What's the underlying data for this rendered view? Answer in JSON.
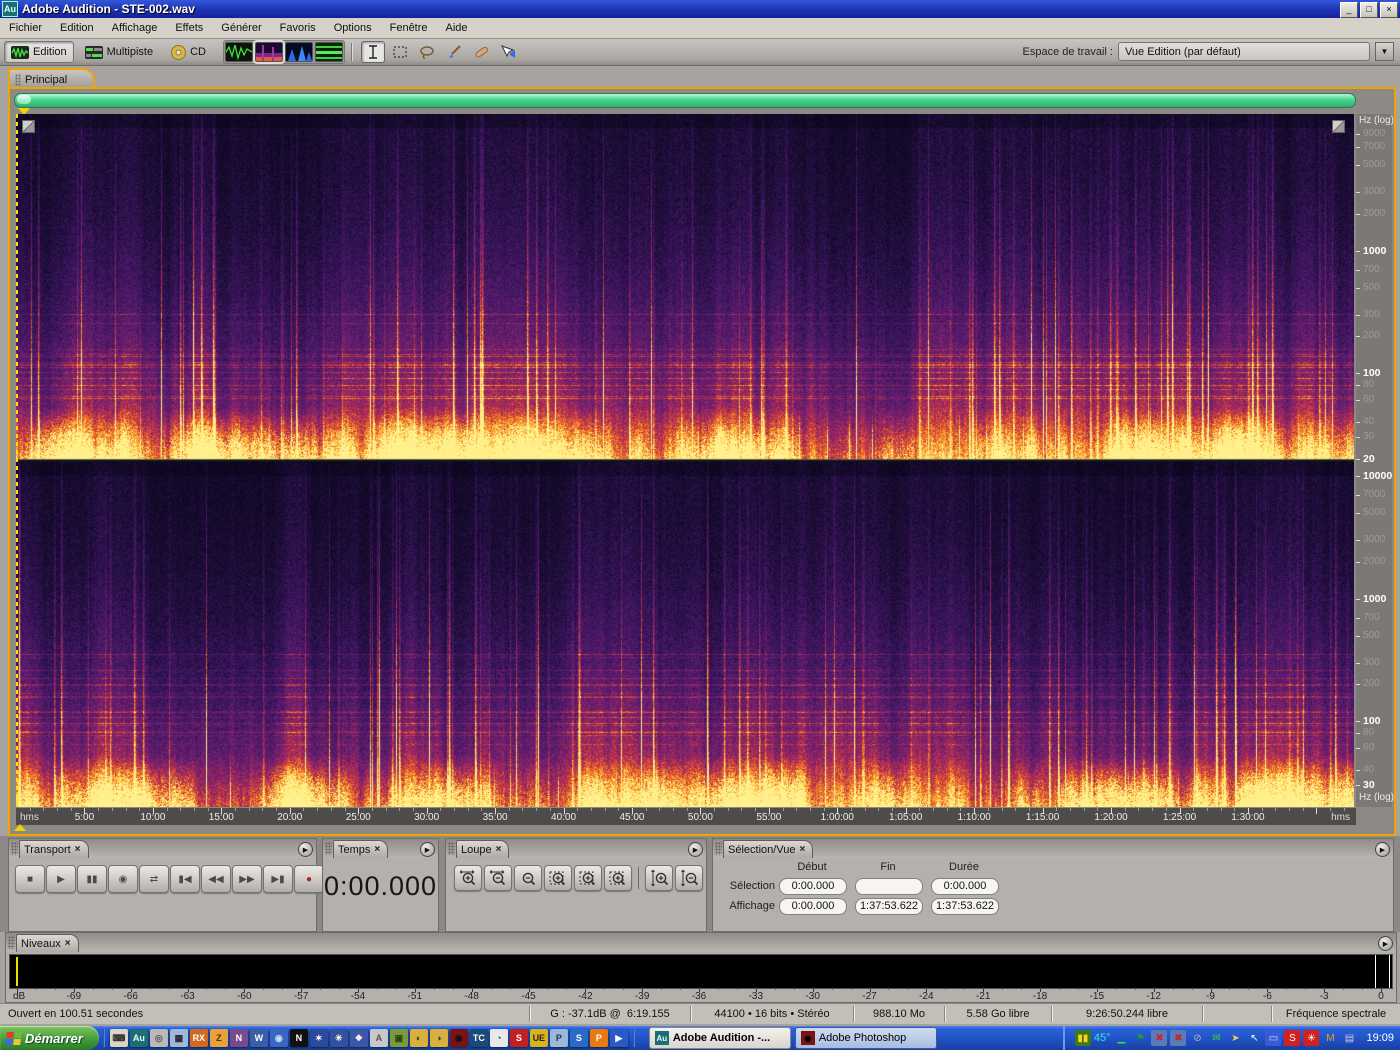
{
  "window": {
    "title": "Adobe Audition - STE-002.wav",
    "app_icon": "Au",
    "controls": [
      {
        "name": "minimize-button",
        "glyph": "_"
      },
      {
        "name": "maximize-button",
        "glyph": "□"
      },
      {
        "name": "close-button",
        "glyph": "×"
      }
    ]
  },
  "menu": {
    "items": [
      "Fichier",
      "Edition",
      "Affichage",
      "Effets",
      "Générer",
      "Favoris",
      "Options",
      "Fenêtre",
      "Aide"
    ]
  },
  "toolbar": {
    "mode_buttons": [
      {
        "name": "edition-view-button",
        "label": "Edition",
        "pressed": true
      },
      {
        "name": "multipiste-view-button",
        "label": "Multipiste",
        "pressed": false
      },
      {
        "name": "cd-view-button",
        "label": "CD",
        "pressed": false
      }
    ],
    "workspace_label": "Espace de travail :",
    "workspace_value": "Vue Edition (par défaut)"
  },
  "main_panel": {
    "tab": "Principal"
  },
  "freq_axis": {
    "channel1": {
      "header": "Hz (log)",
      "ticks": [
        "9000",
        "7000",
        "5000",
        "3000",
        "2000",
        "1000",
        "700",
        "500",
        "300",
        "200",
        "100",
        "80",
        "60",
        "40",
        "30",
        "20"
      ],
      "bold": [
        "1000",
        "100",
        "20"
      ]
    },
    "channel2": {
      "footer": "Hz (log)",
      "ticks": [
        "10000",
        "7000",
        "5000",
        "3000",
        "2000",
        "1000",
        "700",
        "500",
        "300",
        "200",
        "100",
        "80",
        "60",
        "40",
        "30"
      ],
      "bold": [
        "10000",
        "1000",
        "100",
        "30"
      ]
    }
  },
  "timeline": {
    "left_label": "hms",
    "right_label": "hms",
    "duration_seconds": 5873.622,
    "ticks": [
      {
        "s": 300,
        "label": "5:00"
      },
      {
        "s": 600,
        "label": "10:00"
      },
      {
        "s": 900,
        "label": "15:00"
      },
      {
        "s": 1200,
        "label": "20:00"
      },
      {
        "s": 1500,
        "label": "25:00"
      },
      {
        "s": 1800,
        "label": "30:00"
      },
      {
        "s": 2100,
        "label": "35:00"
      },
      {
        "s": 2400,
        "label": "40:00"
      },
      {
        "s": 2700,
        "label": "45:00"
      },
      {
        "s": 3000,
        "label": "50:00"
      },
      {
        "s": 3300,
        "label": "55:00"
      },
      {
        "s": 3600,
        "label": "1:00:00"
      },
      {
        "s": 3900,
        "label": "1:05:00"
      },
      {
        "s": 4200,
        "label": "1:10:00"
      },
      {
        "s": 4500,
        "label": "1:15:00"
      },
      {
        "s": 4800,
        "label": "1:20:00"
      },
      {
        "s": 5100,
        "label": "1:25:00"
      },
      {
        "s": 5400,
        "label": "1:30:00"
      }
    ]
  },
  "transport": {
    "tab": "Transport",
    "buttons": [
      {
        "name": "stop-button",
        "glyph": "■"
      },
      {
        "name": "play-button",
        "glyph": "▶"
      },
      {
        "name": "pause-button",
        "glyph": "▮▮"
      },
      {
        "name": "play-from-cursor-button",
        "glyph": "◉"
      },
      {
        "name": "loop-play-button",
        "glyph": "⇄"
      },
      {
        "name": "go-to-start-button",
        "glyph": "▮◀"
      },
      {
        "name": "rewind-button",
        "glyph": "◀◀"
      },
      {
        "name": "fast-forward-button",
        "glyph": "▶▶"
      },
      {
        "name": "go-to-end-button",
        "glyph": "▶▮"
      },
      {
        "name": "record-button",
        "glyph": "●",
        "color": "#b32222"
      }
    ]
  },
  "temps": {
    "tab": "Temps",
    "value": "0:00.000"
  },
  "loupe": {
    "tab": "Loupe",
    "buttons": [
      {
        "name": "zoom-in-horizontal-button",
        "type": "in-h"
      },
      {
        "name": "zoom-out-horizontal-button",
        "type": "out-h"
      },
      {
        "name": "zoom-out-full-button",
        "type": "out-full"
      },
      {
        "name": "zoom-to-selection-button",
        "type": "sel"
      },
      {
        "name": "zoom-selection-left-button",
        "type": "sel-l"
      },
      {
        "name": "zoom-selection-right-button",
        "type": "sel-r"
      },
      {
        "name": "zoom-in-vertical-button",
        "type": "in-v"
      },
      {
        "name": "zoom-out-vertical-button",
        "type": "out-v"
      }
    ]
  },
  "selection_vue": {
    "tab": "Sélection/Vue",
    "col_headers": [
      "Début",
      "Fin",
      "Durée"
    ],
    "rows": [
      {
        "label": "Sélection",
        "debut": "0:00.000",
        "fin": "",
        "duree": "0:00.000"
      },
      {
        "label": "Affichage",
        "debut": "0:00.000",
        "fin": "1:37:53.622",
        "duree": "1:37:53.622"
      }
    ]
  },
  "niveaux": {
    "tab": "Niveaux",
    "unit": "dB",
    "labels": [
      "-69",
      "-66",
      "-63",
      "-60",
      "-57",
      "-54",
      "-51",
      "-48",
      "-45",
      "-42",
      "-39",
      "-36",
      "-33",
      "-30",
      "-27",
      "-24",
      "-21",
      "-18",
      "-15",
      "-12",
      "-9",
      "-6",
      "-3",
      "0"
    ],
    "range_db": [
      -72,
      0
    ]
  },
  "status_bar": {
    "segments": [
      "Ouvert en 100.51 secondes",
      "G : -37.1dB @  6:19.155",
      "44100 • 16 bits • Stéréo",
      "988.10 Mo",
      "5.58 Go libre",
      "9:26:50.244 libre",
      "",
      "Fréquence spectrale"
    ]
  },
  "taskbar": {
    "start_label": "Démarrer",
    "quick_launch": [
      {
        "name": "keyboard",
        "glyph": "⌨",
        "bg": "#d8d4c8",
        "fg": "#333"
      },
      {
        "name": "audition",
        "glyph": "Au",
        "bg": "#1d6e74",
        "fg": "#dffcff"
      },
      {
        "name": "recorder",
        "glyph": "◎",
        "bg": "#b9b9b9",
        "fg": "#555"
      },
      {
        "name": "calculator",
        "glyph": "▦",
        "bg": "#9db8d8",
        "fg": "#223"
      },
      {
        "name": "rx",
        "glyph": "RX",
        "bg": "#d06a1e",
        "fg": "#fff"
      },
      {
        "name": "zip",
        "glyph": "Z",
        "bg": "#e8a23c",
        "fg": "#5a2a00"
      },
      {
        "name": "onenote",
        "glyph": "N",
        "bg": "#7a4a8e",
        "fg": "#fff"
      },
      {
        "name": "word",
        "glyph": "W",
        "bg": "#3a5fa8",
        "fg": "#fff"
      },
      {
        "name": "planet",
        "glyph": "◉",
        "bg": "#3a66c8",
        "fg": "#cde"
      },
      {
        "name": "netscape",
        "glyph": "N",
        "bg": "#111",
        "fg": "#fff"
      },
      {
        "name": "wand",
        "glyph": "✶",
        "bg": "#2a4a9e",
        "fg": "#fff"
      },
      {
        "name": "burst",
        "glyph": "✳",
        "bg": "#33509e",
        "fg": "#ffd"
      },
      {
        "name": "tickets",
        "glyph": "❖",
        "bg": "#3c57a8",
        "fg": "#fee"
      },
      {
        "name": "acrobat",
        "glyph": "A",
        "bg": "#c8c8c8",
        "fg": "#555"
      },
      {
        "name": "movie",
        "glyph": "▣",
        "bg": "#7a9a3c",
        "fg": "#241"
      },
      {
        "name": "globe-1",
        "glyph": "◐",
        "bg": "#d8b13c",
        "fg": "#235"
      },
      {
        "name": "globe-2",
        "glyph": "◑",
        "bg": "#d8b13c",
        "fg": "#235"
      },
      {
        "name": "photoshop-splash",
        "glyph": "◉",
        "bg": "#7a1414",
        "fg": "#111"
      },
      {
        "name": "tc",
        "glyph": "TC",
        "bg": "#1a4a7a",
        "fg": "#fff"
      },
      {
        "name": "compass",
        "glyph": "◔",
        "bg": "#e8e8e8",
        "fg": "#333"
      },
      {
        "name": "sbp",
        "glyph": "S",
        "bg": "#c02020",
        "fg": "#fff"
      },
      {
        "name": "ultraedit",
        "glyph": "UE",
        "bg": "#d8b320",
        "fg": "#321"
      },
      {
        "name": "messenger",
        "glyph": "P",
        "bg": "#9ab8d8",
        "fg": "#235"
      },
      {
        "name": "swoosh",
        "glyph": "S",
        "bg": "#2a6ac8",
        "fg": "#fff"
      },
      {
        "name": "pdf",
        "glyph": "P",
        "bg": "#e87a10",
        "fg": "#fff"
      },
      {
        "name": "media-player",
        "glyph": "▶",
        "bg": "#2a5ac8",
        "fg": "#fff"
      }
    ],
    "tasks": [
      {
        "name": "task-adobe-audition",
        "label": "Adobe Audition -...",
        "icon": "Au",
        "icon_bg": "#1d6e74",
        "icon_fg": "#dffcff",
        "active": true
      },
      {
        "name": "task-adobe-photoshop",
        "label": "Adobe Photoshop",
        "icon": "◉",
        "icon_bg": "#7a1414",
        "icon_fg": "#000",
        "active": false
      }
    ],
    "tray": {
      "icons": [
        {
          "name": "pause",
          "glyph": "▮▮",
          "bg": "#3a7a1a",
          "fg": "#ffd020"
        },
        {
          "name": "temperature",
          "glyph": "45°",
          "text": true,
          "fg": "#30e8e8"
        },
        {
          "name": "minimized-bar",
          "glyph": "▁",
          "fg": "#40e040"
        },
        {
          "name": "flag",
          "glyph": "⚑",
          "fg": "#2a9a2a"
        },
        {
          "name": "network-off-1",
          "glyph": "✖",
          "bg": "#5a7ab8",
          "fg": "#d02020"
        },
        {
          "name": "network-off-2",
          "glyph": "✖",
          "bg": "#5a7ab8",
          "fg": "#d02020"
        },
        {
          "name": "blocked",
          "glyph": "⊘",
          "fg": "#b8b8b8"
        },
        {
          "name": "package",
          "glyph": "✉",
          "fg": "#3ad03a"
        },
        {
          "name": "scanner",
          "glyph": "➤",
          "fg": "#e8d060"
        },
        {
          "name": "pointer",
          "glyph": "↖",
          "fg": "#ffffff"
        },
        {
          "name": "display",
          "glyph": "▭",
          "bg": "#3a5ad8",
          "fg": "#cde"
        },
        {
          "name": "antivirus",
          "glyph": "S",
          "bg": "#d02020",
          "fg": "#fff"
        },
        {
          "name": "fan",
          "glyph": "✳",
          "bg": "#d02020",
          "fg": "#fff"
        },
        {
          "name": "mouse",
          "glyph": "M",
          "fg": "#e8a020"
        },
        {
          "name": "folder",
          "glyph": "▤",
          "fg": "#c8c8e8"
        }
      ],
      "clock": "19:09"
    }
  }
}
